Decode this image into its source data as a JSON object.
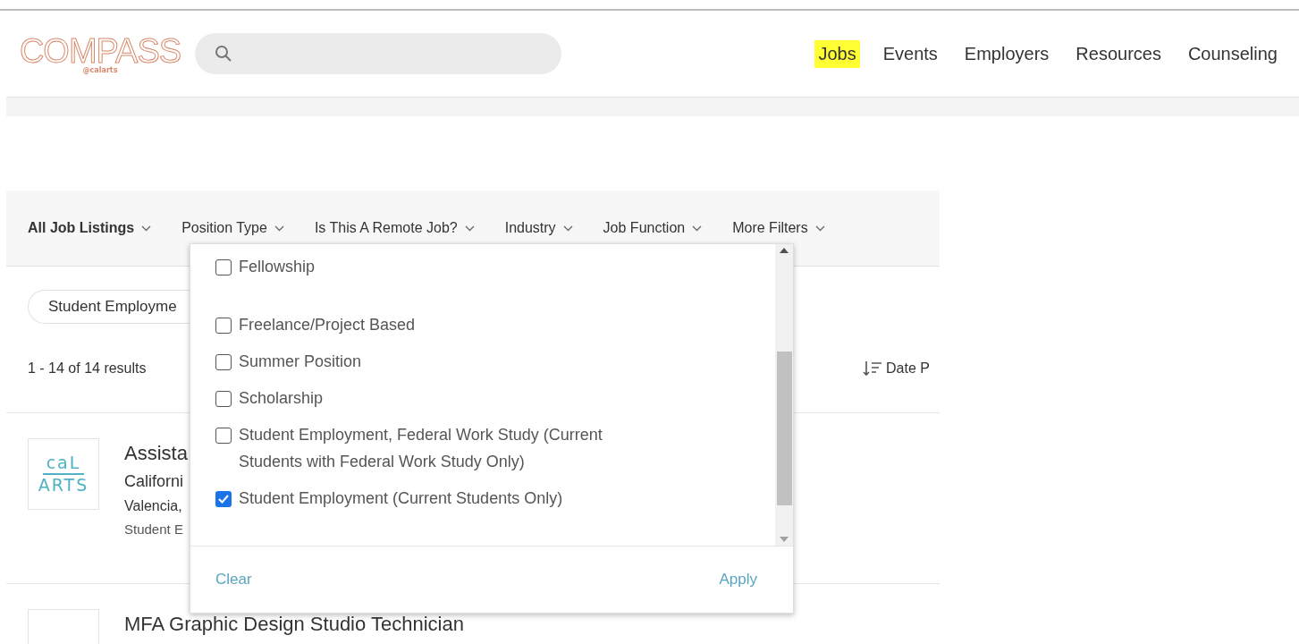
{
  "logo": {
    "name": "COMPASS",
    "tag": "@calarts"
  },
  "nav": [
    {
      "label": "Jobs",
      "selected": true
    },
    {
      "label": "Events",
      "selected": false
    },
    {
      "label": "Employers",
      "selected": false
    },
    {
      "label": "Resources",
      "selected": false
    },
    {
      "label": "Counseling",
      "selected": false
    }
  ],
  "filters": [
    {
      "label": "All Job Listings",
      "bold": true
    },
    {
      "label": "Position Type",
      "bold": false
    },
    {
      "label": "Is This A Remote Job?",
      "bold": false
    },
    {
      "label": "Industry",
      "bold": false
    },
    {
      "label": "Job Function",
      "bold": false
    },
    {
      "label": "More Filters",
      "bold": false
    }
  ],
  "chip": "Student Employme",
  "results": "1 - 14 of 14 results",
  "sort": "Date P",
  "jobs": [
    {
      "logo": [
        "caL",
        "ARTS"
      ],
      "title": "Assista",
      "employer": "Californi",
      "location": "Valencia,",
      "type": "Student E"
    },
    {
      "title": "MFA Graphic Design Studio Technician"
    }
  ],
  "dropdown": {
    "options": [
      {
        "label": "Fellowship",
        "checked": false
      },
      {
        "label": "Freelance/Project Based",
        "checked": false
      },
      {
        "label": "Summer Position",
        "checked": false
      },
      {
        "label": "Scholarship",
        "checked": false
      },
      {
        "label": "Student Employment, Federal Work Study (Current Students with Federal Work Study Only)",
        "checked": false
      },
      {
        "label": "Student Employment (Current Students Only)",
        "checked": true
      }
    ],
    "clear": "Clear",
    "apply": "Apply"
  }
}
